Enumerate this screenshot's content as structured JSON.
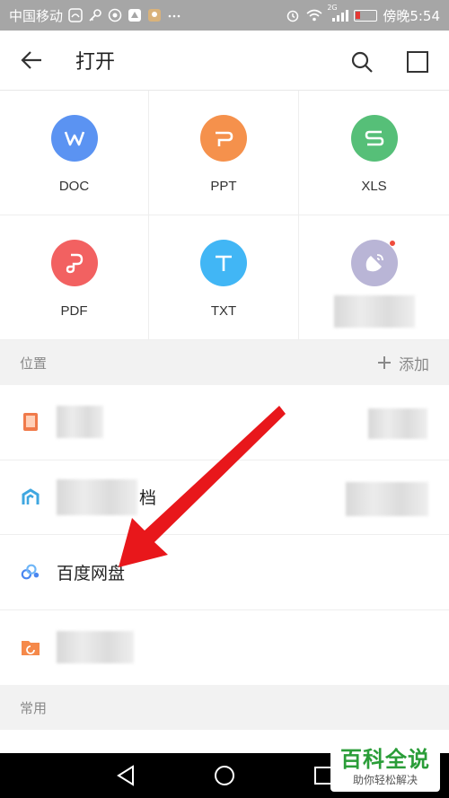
{
  "status_bar": {
    "carrier": "中国移动",
    "time": "傍晚5:54",
    "signal_tag": "2G",
    "icons": [
      "carrier-app-icon",
      "key-icon",
      "app-icon",
      "app-icon",
      "avatar-icon",
      "more-dots-icon",
      "alarm-icon",
      "wifi-icon",
      "signal-icon",
      "battery-low-icon"
    ],
    "battery_color": "#e53935"
  },
  "header": {
    "title": "打开",
    "icons": [
      "back-arrow-icon",
      "search-icon",
      "select-square-icon"
    ]
  },
  "file_types": [
    {
      "label": "DOC",
      "icon": "word-icon",
      "glyph": "W",
      "color": "#5b93f2"
    },
    {
      "label": "PPT",
      "icon": "ppt-icon",
      "glyph": "P",
      "color": "#f5914c"
    },
    {
      "label": "XLS",
      "icon": "excel-icon",
      "glyph": "S",
      "color": "#56bf78"
    },
    {
      "label": "PDF",
      "icon": "pdf-icon",
      "glyph": "P",
      "color": "#f26161"
    },
    {
      "label": "TXT",
      "icon": "txt-icon",
      "glyph": "T",
      "color": "#41b6f5"
    },
    {
      "label": "",
      "icon": "broadcast-icon",
      "glyph": "",
      "color": "#b9b5d6"
    }
  ],
  "locations": {
    "header": "位置",
    "add_label": "添加",
    "items": [
      {
        "label": "",
        "icon": "phone-storage-icon",
        "color": "#f07a4a"
      },
      {
        "label": "档",
        "icon": "cloud-docs-icon",
        "color": "#3fa7e0"
      },
      {
        "label": "百度网盘",
        "icon": "baidu-netdisk-icon",
        "color": "#4a86f0"
      },
      {
        "label": "",
        "icon": "folder-icon",
        "color": "#f5894a"
      }
    ]
  },
  "recent": {
    "header": "常用"
  },
  "nav_bar": {
    "icons": [
      "nav-back-icon",
      "nav-home-icon",
      "nav-recents-icon"
    ]
  },
  "watermark": {
    "title": "百科全说",
    "subtitle": "助你轻松解决",
    "color": "#2a9d38"
  },
  "annotation": {
    "arrow_color": "#e8171b"
  }
}
